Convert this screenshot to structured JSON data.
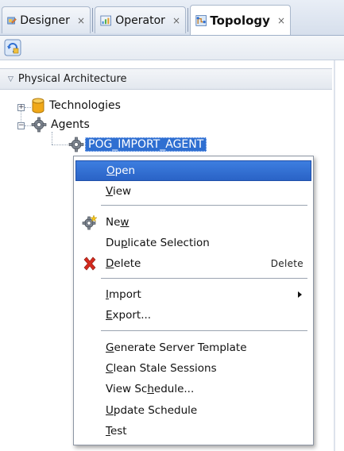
{
  "tabs": [
    {
      "label": "Designer",
      "close": "×",
      "icon": "designer-icon",
      "active": false
    },
    {
      "label": "Operator",
      "close": "×",
      "icon": "operator-icon",
      "active": false
    },
    {
      "label": "Topology",
      "close": "×",
      "icon": "topology-icon",
      "active": true
    }
  ],
  "toolbar": {
    "refresh_icon": "refresh-icon"
  },
  "section": {
    "title": "Physical Architecture",
    "expanded": true
  },
  "tree": {
    "technologies": {
      "label": "Technologies",
      "icon": "database-icon",
      "expander": "+"
    },
    "agents": {
      "label": "Agents",
      "icon": "gear-icon",
      "expander": "−"
    },
    "agent": {
      "label": "POG_IMPORT_AGENT",
      "icon": "gear-icon",
      "selected": true
    }
  },
  "menu": {
    "items": [
      {
        "label": "Open",
        "mnemonic": "O",
        "highlighted": true
      },
      {
        "label": "View",
        "mnemonic": "V"
      },
      {
        "label": "New",
        "mnemonic": "w",
        "icon": "new-gear-icon"
      },
      {
        "label": "Duplicate Selection",
        "mnemonic": "p"
      },
      {
        "label": "Delete",
        "mnemonic": "D",
        "icon": "delete-x-icon",
        "shortcut": "Delete"
      },
      {
        "label": "Import",
        "mnemonic": "I",
        "submenu": true
      },
      {
        "label": "Export...",
        "mnemonic": "E"
      },
      {
        "label": "Generate Server Template",
        "mnemonic": "G"
      },
      {
        "label": "Clean Stale Sessions",
        "mnemonic": "C"
      },
      {
        "label": "View Schedule...",
        "mnemonic": "h"
      },
      {
        "label": "Update Schedule",
        "mnemonic": "U"
      },
      {
        "label": "Test",
        "mnemonic": "T"
      }
    ]
  },
  "colors": {
    "selection": "#2f6fd1",
    "menu_highlight": "#2a63c6",
    "delete_icon": "#d42a1e",
    "db_icon": "#f0a818"
  }
}
